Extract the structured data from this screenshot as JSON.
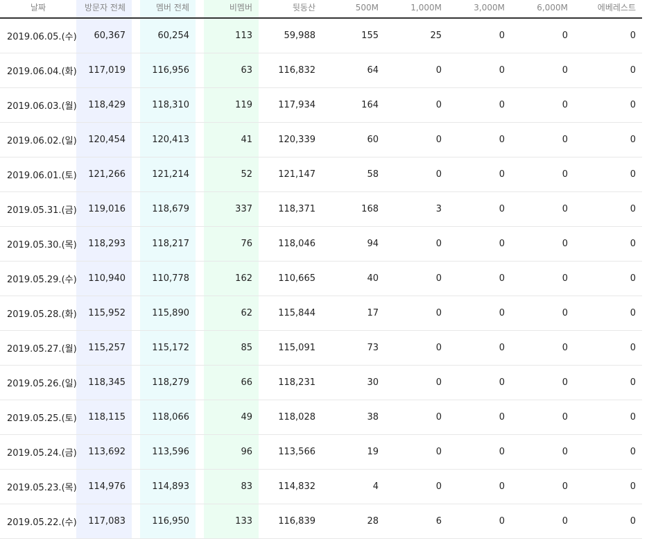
{
  "table": {
    "headers": [
      "날짜",
      "방문자 전체",
      "멤버 전체",
      "비멤버",
      "뒷동산",
      "500M",
      "1,000M",
      "3,000M",
      "6,000M",
      "에베레스트"
    ],
    "rows": [
      [
        "2019.06.05.(수)",
        "60,367",
        "60,254",
        "113",
        "59,988",
        "155",
        "25",
        "0",
        "0",
        "0"
      ],
      [
        "2019.06.04.(화)",
        "117,019",
        "116,956",
        "63",
        "116,832",
        "64",
        "0",
        "0",
        "0",
        "0"
      ],
      [
        "2019.06.03.(월)",
        "118,429",
        "118,310",
        "119",
        "117,934",
        "164",
        "0",
        "0",
        "0",
        "0"
      ],
      [
        "2019.06.02.(일)",
        "120,454",
        "120,413",
        "41",
        "120,339",
        "60",
        "0",
        "0",
        "0",
        "0"
      ],
      [
        "2019.06.01.(토)",
        "121,266",
        "121,214",
        "52",
        "121,147",
        "58",
        "0",
        "0",
        "0",
        "0"
      ],
      [
        "2019.05.31.(금)",
        "119,016",
        "118,679",
        "337",
        "118,371",
        "168",
        "3",
        "0",
        "0",
        "0"
      ],
      [
        "2019.05.30.(목)",
        "118,293",
        "118,217",
        "76",
        "118,046",
        "94",
        "0",
        "0",
        "0",
        "0"
      ],
      [
        "2019.05.29.(수)",
        "110,940",
        "110,778",
        "162",
        "110,665",
        "40",
        "0",
        "0",
        "0",
        "0"
      ],
      [
        "2019.05.28.(화)",
        "115,952",
        "115,890",
        "62",
        "115,844",
        "17",
        "0",
        "0",
        "0",
        "0"
      ],
      [
        "2019.05.27.(월)",
        "115,257",
        "115,172",
        "85",
        "115,091",
        "73",
        "0",
        "0",
        "0",
        "0"
      ],
      [
        "2019.05.26.(일)",
        "118,345",
        "118,279",
        "66",
        "118,231",
        "30",
        "0",
        "0",
        "0",
        "0"
      ],
      [
        "2019.05.25.(토)",
        "118,115",
        "118,066",
        "49",
        "118,028",
        "38",
        "0",
        "0",
        "0",
        "0"
      ],
      [
        "2019.05.24.(금)",
        "113,692",
        "113,596",
        "96",
        "113,566",
        "19",
        "0",
        "0",
        "0",
        "0"
      ],
      [
        "2019.05.23.(목)",
        "114,976",
        "114,893",
        "83",
        "114,832",
        "4",
        "0",
        "0",
        "0",
        "0"
      ],
      [
        "2019.05.22.(수)",
        "117,083",
        "116,950",
        "133",
        "116,839",
        "28",
        "6",
        "0",
        "0",
        "0"
      ]
    ]
  },
  "colors": {
    "visitors_col_bg": "#eef2fe",
    "members_col_bg": "#ebfbfc",
    "nonmembers_col_bg": "#ebfdf2",
    "header_rule": "#333333",
    "row_rule": "#e8e8e8"
  }
}
